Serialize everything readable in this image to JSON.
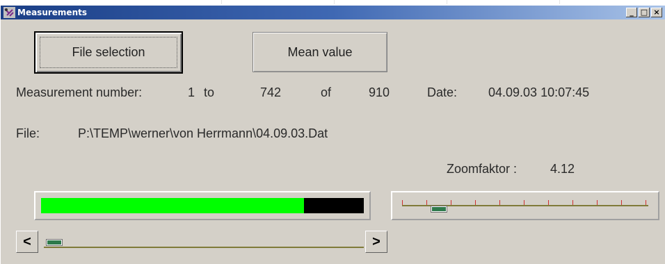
{
  "window": {
    "title": "Measurements",
    "icon": "satellite-icon",
    "controls": [
      "minimize-icon",
      "maximize-icon",
      "close-icon"
    ]
  },
  "buttons": {
    "file_selection": "File selection",
    "mean_value": "Mean value"
  },
  "measurement": {
    "label": "Measurement number:",
    "from": "1",
    "to_word": "to",
    "to": "742",
    "of_word": "of",
    "total": "910",
    "date_label": "Date:",
    "date_value": "04.09.03 10:07:45"
  },
  "file": {
    "label": "File:",
    "path": "P:\\TEMP\\werner\\von Herrmann\\04.09.03.Dat"
  },
  "zoom": {
    "label": "Zoomfaktor :",
    "value": "4.12",
    "slider_position": 0.15
  },
  "progress": {
    "fraction": 0.815,
    "fill_color": "#00ff00",
    "track_color": "#000000"
  },
  "navigation": {
    "prev_label": "<",
    "next_label": ">",
    "position_fraction": 0.0
  }
}
